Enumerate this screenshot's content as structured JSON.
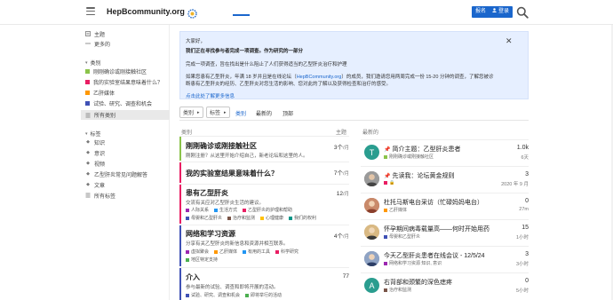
{
  "header": {
    "logo_text": "HepBcommunity.org",
    "signup_label": "报名",
    "login_label": "登录"
  },
  "sidebar": {
    "top_items": [
      {
        "icon": "topics-icon",
        "label": "主题"
      },
      {
        "icon": "more-icon",
        "label": "更多的"
      }
    ],
    "categories_head": "类别",
    "categories": [
      {
        "color": "#8BC34A",
        "label": "刚刚确诊或刚接触社区"
      },
      {
        "color": "#E91E63",
        "label": "我的实验室结果意味着什么？"
      },
      {
        "color": "#FF9800",
        "label": "乙肝媒体"
      },
      {
        "color": "#3F51B5",
        "label": "试验、研究、调查和机会"
      },
      {
        "icon": "list-icon",
        "label": "所有类别"
      }
    ],
    "tags_head": "标签",
    "tags": [
      {
        "icon": "tag-icon",
        "label": "知识"
      },
      {
        "icon": "tag-icon",
        "label": "意识"
      },
      {
        "icon": "tag-icon",
        "label": "视频"
      },
      {
        "icon": "tag-icon",
        "label": "乙型肝炎常见问题解答"
      },
      {
        "icon": "tag-icon",
        "label": "文章"
      },
      {
        "icon": "tag-icon",
        "label": "所有标签"
      }
    ]
  },
  "banner": {
    "greeting": "大家好，",
    "headline": "我们正在寻找参与者完成一项调查。作为研究的一部分",
    "line1": "完成一项调查，旨在找出是什么阻止了人们获得适当的乙型肝炎治疗和护理",
    "line2a": "如果您患有乙型肝炎，年满 18 岁并且是在线论坛（",
    "line2_link": "HepBCommunity.org",
    "line2b": "）的成员，我们邀请您用两周完成一份 15-20 分钟的调查，了解您被诊",
    "line3": "断患有乙型肝炎的经历、乙型肝炎对您生活的影响、您对此的了解以及获得检查和治疗的感受。",
    "link": "点击此处了解更多信息"
  },
  "nav": {
    "category_dropdown": "类别",
    "tag_dropdown": "标签",
    "tabs": [
      "类别",
      "最新的",
      "顶部"
    ]
  },
  "list": {
    "col_category": "类别",
    "col_topics": "主题",
    "col_latest": "最新的",
    "categories": [
      {
        "color": "#8BC34A",
        "title": "刚刚确诊或刚接触社区",
        "desc": "刚刚注册？从这里开始介绍自己，新老论坛和这里的人。",
        "count": "3个",
        "unit": "/月",
        "subs": []
      },
      {
        "color": "#E91E63",
        "title": "我的实验室结果意味着什么？",
        "desc": "",
        "count": "7个",
        "unit": "/月",
        "subs": []
      },
      {
        "color": "#E91E63",
        "title": "患有乙型肝炎",
        "desc": "交流有关应对乙型肝炎生活的建议。",
        "count": "12",
        "unit": "/月",
        "subs": [
          [
            {
              "c": "#9C27B0",
              "t": "人际关系"
            },
            {
              "c": "#2196F3",
              "t": "生活方式"
            },
            {
              "c": "#E91E63",
              "t": "乙型肝炎的护理和帮助"
            }
          ],
          [
            {
              "c": "#3F51B5",
              "t": "母婴和乙型肝炎"
            },
            {
              "c": "#795548",
              "t": "治疗和监测"
            },
            {
              "c": "#FFC107",
              "t": "心理健康"
            },
            {
              "c": "#009688",
              "t": "我们的权利"
            }
          ]
        ]
      },
      {
        "color": "#3F51B5",
        "title": "网络和学习资源",
        "desc": "分享有关乙型肝炎的新信息和资源并相互联系。",
        "count": "4个",
        "unit": "/月",
        "subs": [
          [
            {
              "c": "#9C27B0",
              "t": "虚拟聚会"
            },
            {
              "c": "#FF9800",
              "t": "乙肝媒体"
            },
            {
              "c": "#2196F3",
              "t": "有用的工具"
            },
            {
              "c": "#E91E63",
              "t": "科学研究"
            }
          ],
          [
            {
              "c": "#4CAF50",
              "t": "地区特定支持"
            }
          ]
        ]
      },
      {
        "color": "#3F51B5",
        "title": "介入",
        "desc": "参与最新的试验、调查和即将开展的活动。",
        "count": "77",
        "unit": "",
        "subs": [
          [
            {
              "c": "#3F51B5",
              "t": "试验、研究、调查和机会"
            },
            {
              "c": "#4CAF50",
              "t": "即将举行的活动"
            }
          ]
        ]
      }
    ],
    "latest": [
      {
        "avatar": "T",
        "avatar_color": "#2a9d8f",
        "pinned": true,
        "title": "简介主题：乙型肝炎患者",
        "cat_color": "#8BC34A",
        "cat": "刚刚确诊或刚接触社区",
        "num": "1.0k",
        "time": "6天"
      },
      {
        "avatar": "photo",
        "avatar_color": "#7a7a7a",
        "pinned": true,
        "title": "先读我：论坛黄金规则",
        "cat_color": "#E91E63",
        "cat": "",
        "num": "3",
        "time": "2020 年 9 月"
      },
      {
        "avatar": "photo",
        "avatar_color": "#b85c4a",
        "pinned": false,
        "title": "杜托马斯电台采访（忙碌妈妈电台）",
        "cat_color": "#FF9800",
        "cat": "乙肝媒体",
        "num": "0",
        "time": "27m"
      },
      {
        "avatar": "photo",
        "avatar_color": "#c9a46b",
        "pinned": false,
        "title": "怀孕期间病毒载量高——何时开始用药",
        "cat_color": "#3F51B5",
        "cat": "母婴和乙型肝炎",
        "num": "15",
        "time": "1小时"
      },
      {
        "avatar": "photo",
        "avatar_color": "#6b7fa8",
        "pinned": false,
        "title": "今天乙型肝炎患者在线会议 - 12/5/24",
        "cat_color": "#9C27B0",
        "cat": "网络和学习资源  知识, 意识",
        "num": "3",
        "time": "3小时"
      },
      {
        "avatar": "A",
        "avatar_color": "#2a9d8f",
        "pinned": false,
        "title": "右背部和颈繁的深色痣疼",
        "cat_color": "#795548",
        "cat": "治疗和监测",
        "num": "0",
        "time": "5小时"
      }
    ]
  }
}
